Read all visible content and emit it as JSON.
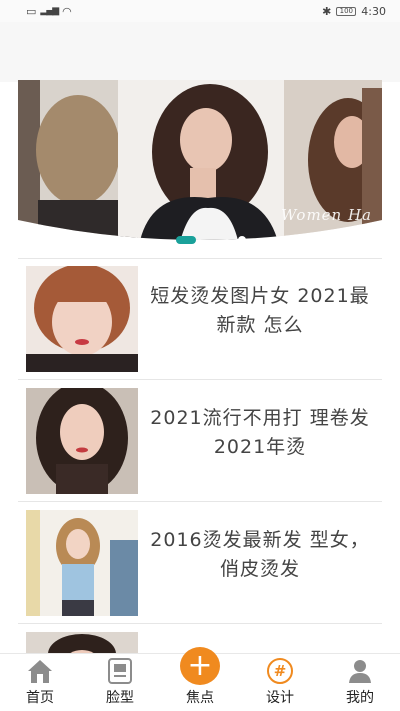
{
  "status": {
    "time": "4:30",
    "battery": "100"
  },
  "banner": {
    "caption": "Women Ha"
  },
  "articles": [
    {
      "title": "短发烫发图片女 2021最新款 怎么"
    },
    {
      "title": "2021流行不用打 理卷发 2021年烫"
    },
    {
      "title": "2016烫发最新发 型女，俏皮烫发"
    }
  ],
  "tabs": [
    {
      "label": "首页",
      "icon": "home-icon"
    },
    {
      "label": "脸型",
      "icon": "face-shape-icon"
    },
    {
      "label": "焦点",
      "icon": "plus-icon"
    },
    {
      "label": "设计",
      "icon": "hash-icon"
    },
    {
      "label": "我的",
      "icon": "user-icon"
    }
  ],
  "colors": {
    "accent": "#f08a1f",
    "indicator": "#1aa19a"
  }
}
